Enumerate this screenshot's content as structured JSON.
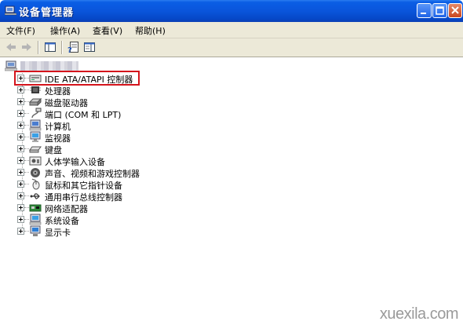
{
  "window": {
    "title": "设备管理器"
  },
  "menu": [
    {
      "label": "文件(F)"
    },
    {
      "label": "操作(A)"
    },
    {
      "label": "查看(V)"
    },
    {
      "label": "帮助(H)"
    }
  ],
  "toolbar": {
    "buttons": [
      "back-icon",
      "forward-icon",
      "console-tree-icon",
      "properties-icon",
      "help-icon"
    ]
  },
  "tree": {
    "root_label": "",
    "items": [
      {
        "label": "IDE ATA/ATAPI 控制器",
        "icon": "ide-controller-icon"
      },
      {
        "label": "处理器",
        "icon": "processor-icon"
      },
      {
        "label": "磁盘驱动器",
        "icon": "disk-drive-icon"
      },
      {
        "label": "端口 (COM 和 LPT)",
        "icon": "port-icon"
      },
      {
        "label": "计算机",
        "icon": "computer-icon"
      },
      {
        "label": "监视器",
        "icon": "monitor-icon"
      },
      {
        "label": "键盘",
        "icon": "keyboard-icon"
      },
      {
        "label": "人体学输入设备",
        "icon": "hid-icon"
      },
      {
        "label": "声音、视频和游戏控制器",
        "icon": "sound-icon"
      },
      {
        "label": "鼠标和其它指针设备",
        "icon": "mouse-icon"
      },
      {
        "label": "通用串行总线控制器",
        "icon": "usb-icon"
      },
      {
        "label": "网络适配器",
        "icon": "network-adapter-icon"
      },
      {
        "label": "系统设备",
        "icon": "system-device-icon"
      },
      {
        "label": "显示卡",
        "icon": "display-adapter-icon"
      }
    ]
  },
  "watermark": "xuexila.com",
  "colors": {
    "title_bar": "#0a55db",
    "highlight": "#d4141c",
    "chrome": "#ece9d8"
  }
}
